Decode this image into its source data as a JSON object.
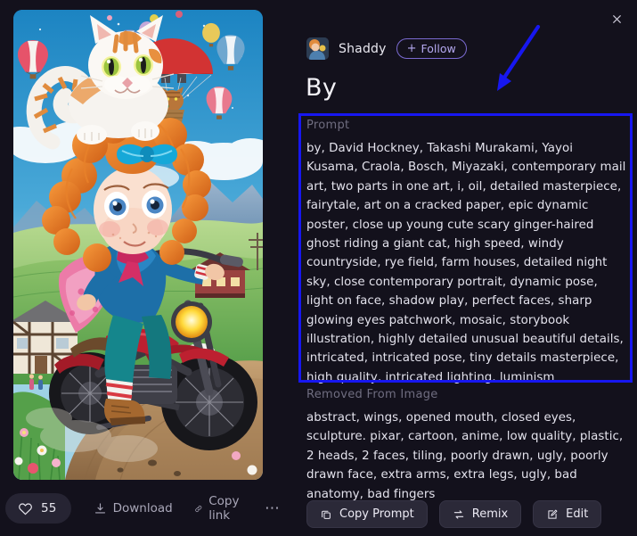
{
  "colors": {
    "background": "#13111c",
    "annotation": "#1717f0",
    "follow_accent": "#7a6ad0",
    "button_face": "#2b2938",
    "muted_text": "#6f6d80",
    "body_text": "#e3e2ec"
  },
  "close": {
    "icon": "close-icon"
  },
  "author": {
    "avatar_icon": "avatar-thumbnail",
    "name": "Shaddy",
    "follow_label": "Follow",
    "follow_plus": "+"
  },
  "heading": {
    "title": "By"
  },
  "prompt": {
    "label": "Prompt",
    "text": "by, David Hockney, Takashi Murakami, Yayoi Kusama, Craola, Bosch, Miyazaki, contemporary mail art, two parts in one art, i, oil, detailed masterpiece, fairytale, art on a cracked paper, epic dynamic poster, close up young cute scary ginger-haired ghost riding a giant cat, high speed, windy countryside, rye field, farm houses, detailed night sky, close contemporary portrait, dynamic pose, light on face, shadow play, perfect faces, sharp glowing eyes patchwork, mosaic, storybook illustration, highly detailed unusual beautiful details, intricated, intricated pose, tiny details masterpiece, high quality, intricated lighting, luminism"
  },
  "removed": {
    "label": "Removed From Image",
    "text": "abstract, wings, opened mouth, closed eyes, sculpture. pixar, cartoon, anime, low quality, plastic, 2 heads, 2 faces, tiling, poorly drawn, ugly, poorly drawn face, extra arms, extra legs, ugly, bad anatomy, bad fingers"
  },
  "detail_buttons": [
    {
      "label": "Copy Prompt",
      "icon": "copy-icon"
    },
    {
      "label": "Remix",
      "icon": "remix-icon"
    },
    {
      "label": "Edit",
      "icon": "edit-icon"
    }
  ],
  "image_actions": {
    "like_count": "55",
    "like_icon": "heart-icon",
    "download_label": "Download",
    "download_icon": "download-icon",
    "copy_link_label": "Copy link",
    "copy_link_icon": "link-icon",
    "more_label": "⋯"
  },
  "artwork": {
    "alt": "ginger-haired girl riding a motorcycle with a giant orange and white cat on her head, hot air balloons and a parachuting cat in the sky, countryside with farm houses"
  }
}
